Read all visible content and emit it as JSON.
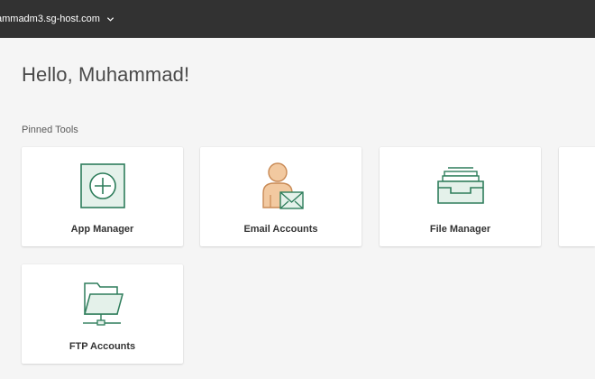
{
  "header": {
    "site_name": "ammadm3.sg-host.com"
  },
  "greeting": "Hello, Muhammad!",
  "pinned": {
    "label": "Pinned Tools",
    "tools": [
      {
        "label": "App Manager",
        "icon": "app-manager-icon"
      },
      {
        "label": "Email Accounts",
        "icon": "email-accounts-icon"
      },
      {
        "label": "File Manager",
        "icon": "file-manager-icon"
      },
      {
        "label": "FTP Accounts",
        "icon": "ftp-accounts-icon"
      }
    ]
  },
  "colors": {
    "topbar": "#323232",
    "icon_green": "#2e7d5b",
    "icon_green_light": "#e4f1ea",
    "avatar_tan": "#f2c9a0",
    "avatar_line": "#c98a55"
  }
}
